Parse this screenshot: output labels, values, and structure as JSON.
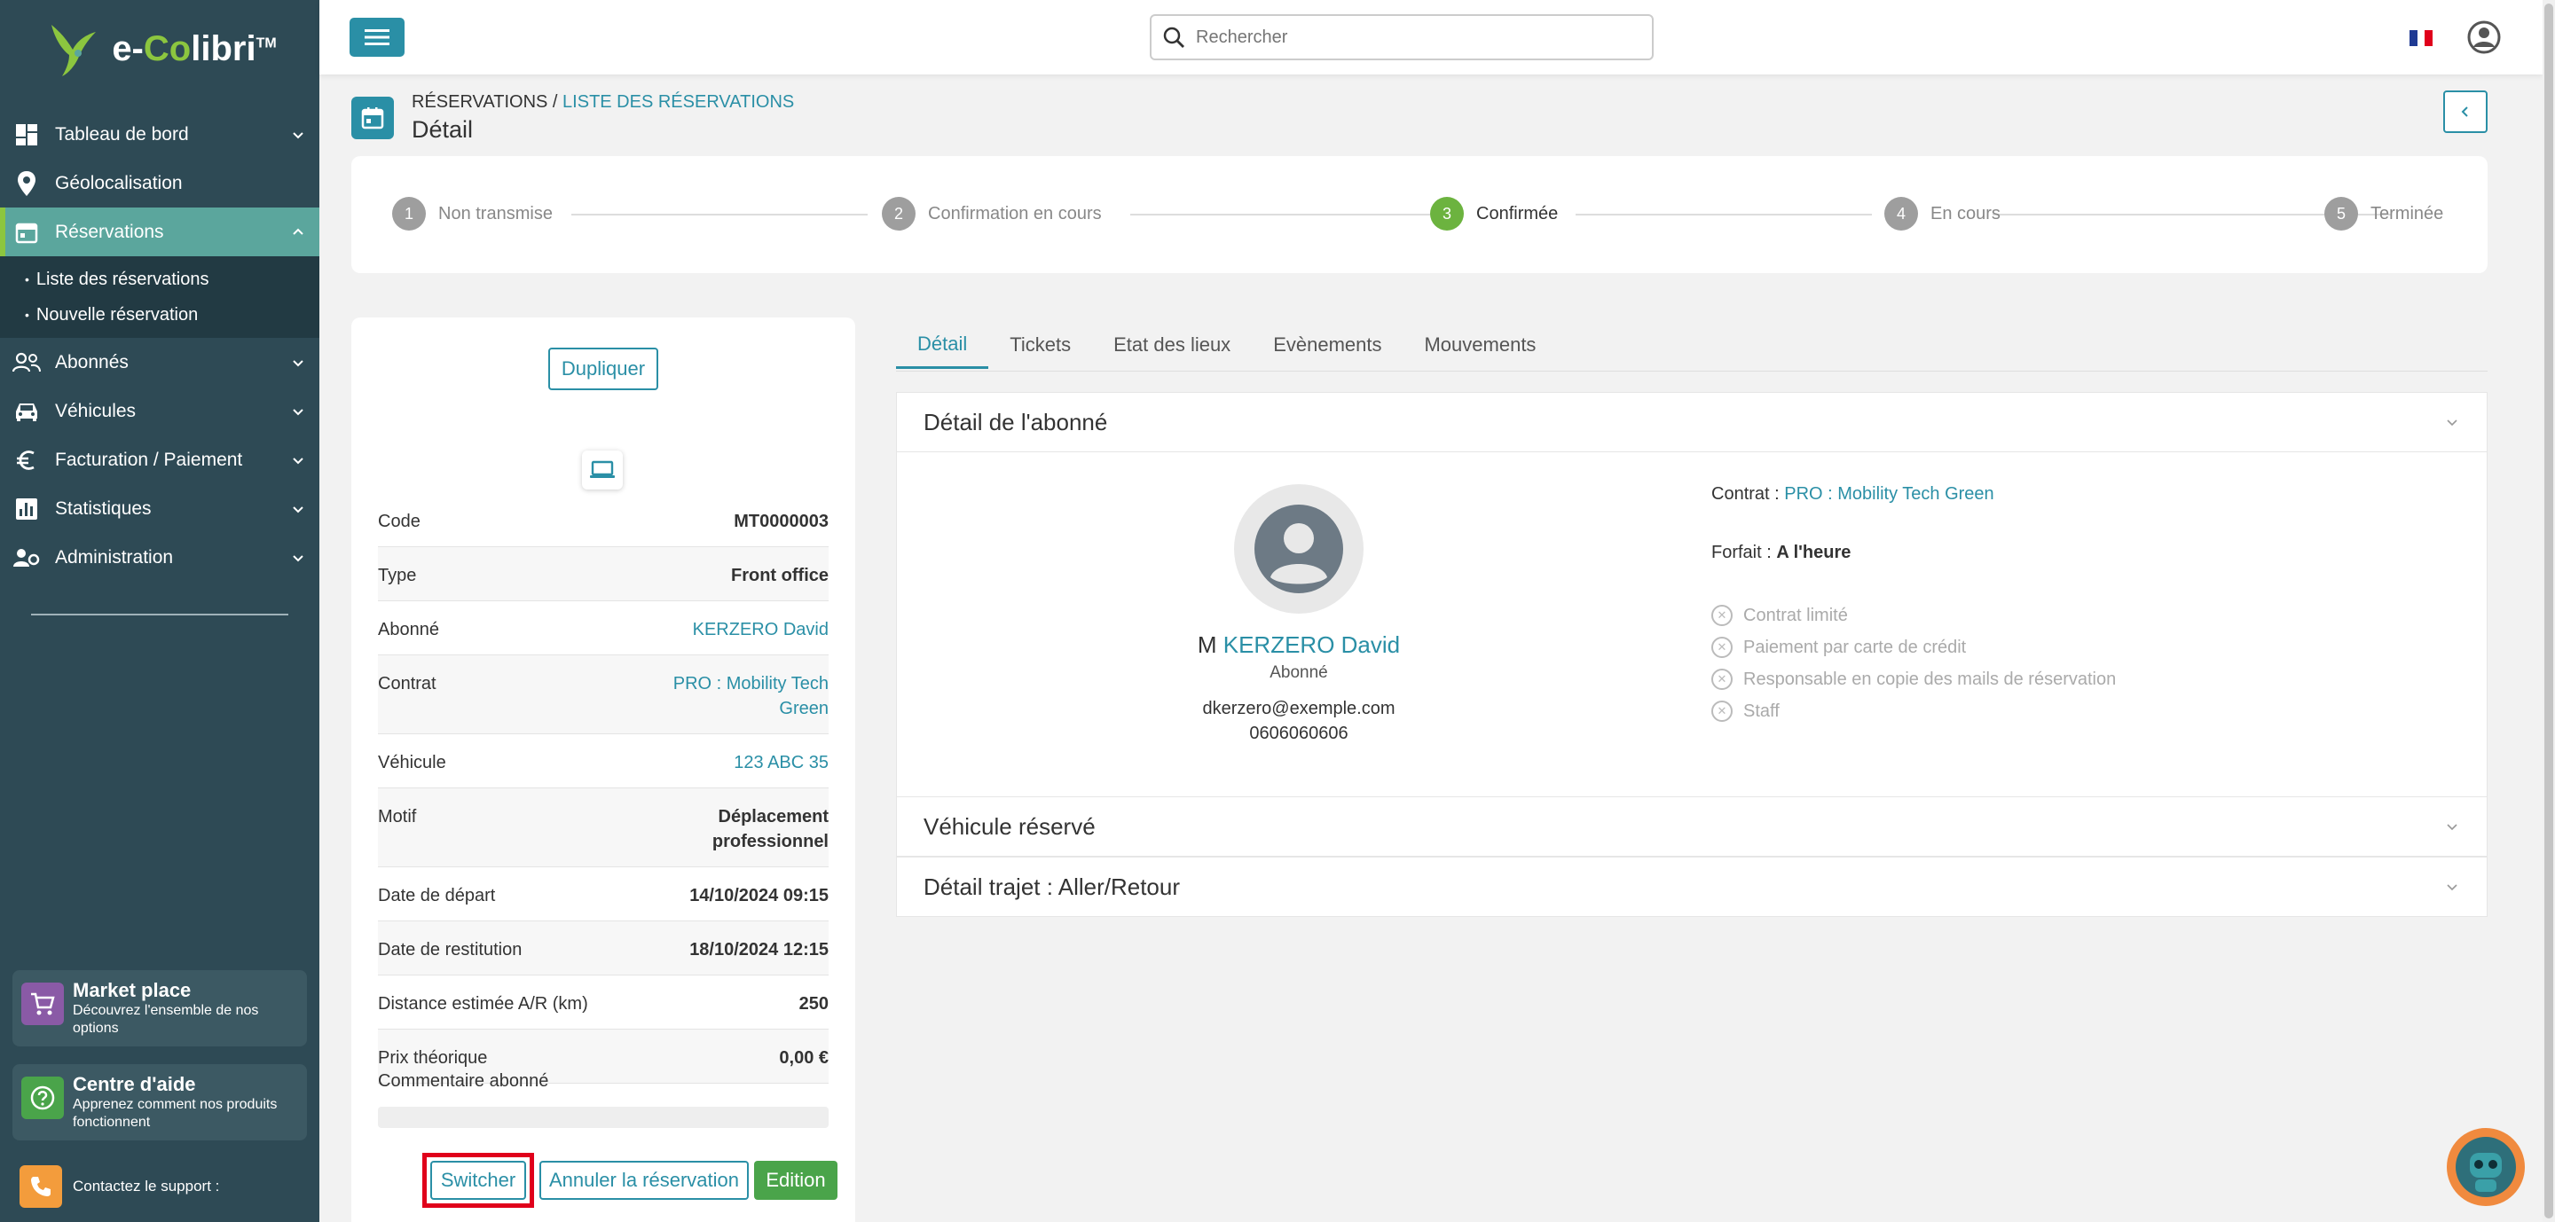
{
  "brand": {
    "logo_prefix": "e-",
    "logo_co": "Co",
    "logo_suffix": "libri",
    "logo_tm": "TM"
  },
  "sidebar": {
    "items": [
      {
        "label": "Tableau de bord"
      },
      {
        "label": "Géolocalisation"
      },
      {
        "label": "Réservations"
      },
      {
        "label": "Abonnés"
      },
      {
        "label": "Véhicules"
      },
      {
        "label": "Facturation / Paiement"
      },
      {
        "label": "Statistiques"
      },
      {
        "label": "Administration"
      }
    ],
    "sub_items": [
      {
        "label": "Liste des réservations"
      },
      {
        "label": "Nouvelle réservation"
      }
    ],
    "marketplace": {
      "title": "Market place",
      "desc": "Découvrez l'ensemble de nos options"
    },
    "help": {
      "title": "Centre d'aide",
      "desc": "Apprenez comment nos produits fonctionnent"
    },
    "support": {
      "label": "Contactez le support :"
    }
  },
  "topbar": {
    "search_placeholder": "Rechercher"
  },
  "breadcrumb": {
    "root": "RÉSERVATIONS",
    "separator": " / ",
    "current": "LISTE DES RÉSERVATIONS"
  },
  "page_title": "Détail",
  "steps": [
    {
      "num": "1",
      "label": "Non transmise"
    },
    {
      "num": "2",
      "label": "Confirmation en cours"
    },
    {
      "num": "3",
      "label": "Confirmée"
    },
    {
      "num": "4",
      "label": "En cours"
    },
    {
      "num": "5",
      "label": "Terminée"
    }
  ],
  "card": {
    "duplicate_label": "Dupliquer",
    "rows": [
      {
        "key": "Code",
        "value": "MT0000003"
      },
      {
        "key": "Type",
        "value": "Front office"
      },
      {
        "key": "Abonné",
        "value": "KERZERO David"
      },
      {
        "key": "Contrat",
        "value": "PRO : Mobility Tech Green"
      },
      {
        "key": "Véhicule",
        "value": "123 ABC 35"
      },
      {
        "key": "Motif",
        "value": "Déplacement professionnel"
      },
      {
        "key": "Date de départ",
        "value": "14/10/2024 09:15"
      },
      {
        "key": "Date de restitution",
        "value": "18/10/2024 12:15"
      },
      {
        "key": "Distance estimée A/R (km)",
        "value": "250"
      },
      {
        "key": "Prix théorique",
        "value": "0,00 €"
      }
    ],
    "comment_label": "Commentaire abonné",
    "switch_label": "Switcher",
    "cancel_label": "Annuler la réservation",
    "edit_label": "Edition"
  },
  "tabs": [
    {
      "label": "Détail"
    },
    {
      "label": "Tickets"
    },
    {
      "label": "Etat des lieux"
    },
    {
      "label": "Evènements"
    },
    {
      "label": "Mouvements"
    }
  ],
  "subscriber_panel": {
    "title": "Détail de l'abonné",
    "civility": "M",
    "name": "KERZERO David",
    "role": "Abonné",
    "email": "dkerzero@exemple.com",
    "phone": "0606060606",
    "contract_label": "Contrat : ",
    "contract_value": "PRO : Mobility Tech Green",
    "forfait_label": "Forfait : ",
    "forfait_value": "A l'heure",
    "options": [
      {
        "label": "Contrat limité"
      },
      {
        "label": "Paiement par carte de crédit"
      },
      {
        "label": "Responsable en copie des mails de réservation"
      },
      {
        "label": "Staff"
      }
    ]
  },
  "vehicle_panel": {
    "title": "Véhicule réservé"
  },
  "trip_panel": {
    "title": "Détail trajet : Aller/Retour"
  },
  "colors": {
    "primary": "#2a8fa6",
    "sidebar": "#2e4a55",
    "active_green": "#6cb33f",
    "highlight": "#e0001b"
  }
}
